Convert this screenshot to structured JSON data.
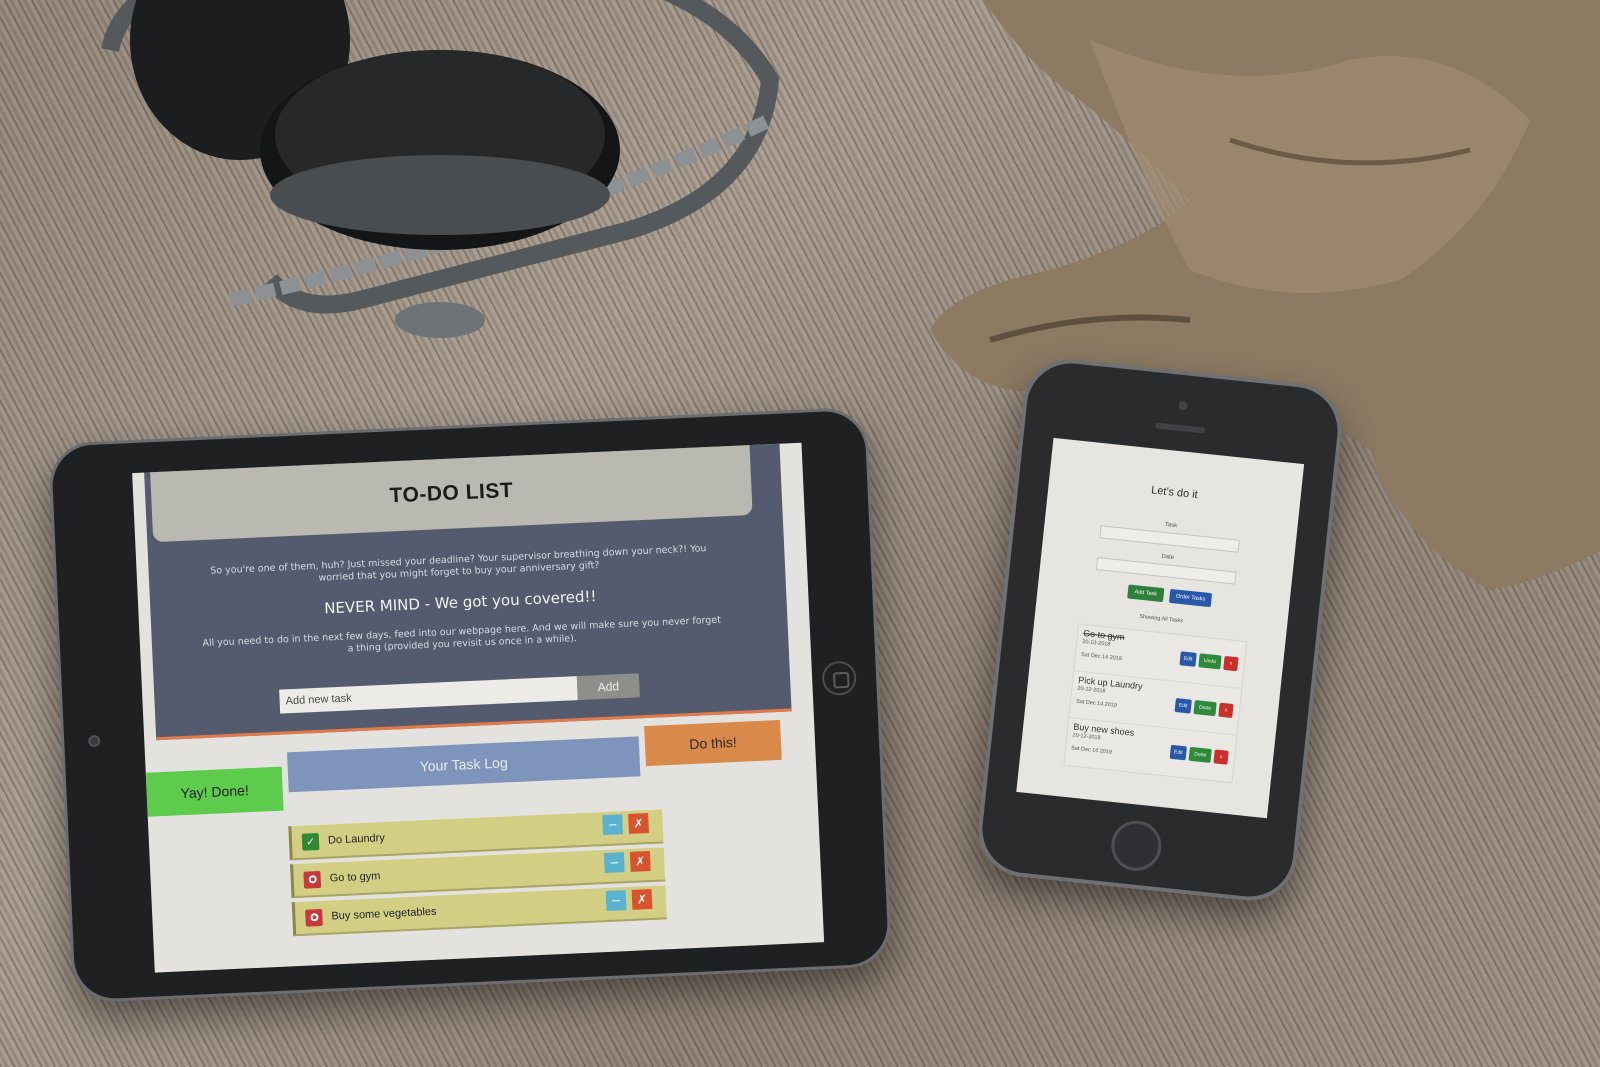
{
  "tablet": {
    "title": "TO-DO LIST",
    "intro": "So you're one of them, huh? Just missed your deadline? Your supervisor breathing down your neck?! You worried that you might forget to buy your anniversary gift?",
    "headline": "NEVER MIND - We got you covered!!",
    "note": "All you need to do in the next few days, feed into our webpage here. And we will make sure you never forget a thing (provided you revisit us once in a while).",
    "add_placeholder": "Add new task",
    "add_label": "Add",
    "tabs": {
      "done": "Yay! Done!",
      "log": "Your Task Log",
      "todo": "Do this!"
    },
    "tasks": [
      {
        "label": "Do Laundry",
        "status": "done",
        "status_icon": "✓",
        "edit_icon": "−",
        "delete_icon": "✗"
      },
      {
        "label": "Go to gym",
        "status": "pending",
        "edit_icon": "−",
        "delete_icon": "✗"
      },
      {
        "label": "Buy some vegetables",
        "status": "pending",
        "edit_icon": "−",
        "delete_icon": "✗"
      }
    ],
    "colors": {
      "hero": "#555b6e",
      "done": "#5dcb4b",
      "log": "#7f94bb",
      "todo": "#d98a4a",
      "task": "#d2cf85"
    }
  },
  "phone": {
    "title": "Let's do it",
    "task_label": "Task",
    "date_label": "Date",
    "add_task_label": "Add Task",
    "order_tasks_label": "Order Tasks",
    "showing_label": "Showing All Tasks",
    "items": [
      {
        "name": "Go to gym",
        "date": "20-10-2018",
        "created": "Sat Dec 14 2019",
        "edit": "Edit",
        "toggle": "Undo",
        "delete": "x",
        "completed": true
      },
      {
        "name": "Pick up Laundry",
        "date": "20-12-2018",
        "created": "Sat Dec 14 2019",
        "edit": "Edit",
        "toggle": "Done",
        "delete": "x",
        "completed": false
      },
      {
        "name": "Buy new shoes",
        "date": "20-12-2018",
        "created": "Sat Dec 14 2019",
        "edit": "Edit",
        "toggle": "Done",
        "delete": "x",
        "completed": false
      }
    ]
  }
}
